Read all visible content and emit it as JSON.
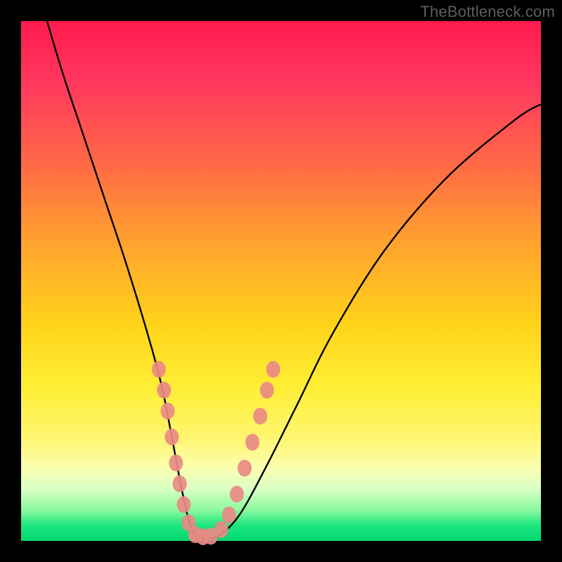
{
  "watermark": "TheBottleneck.com",
  "chart_data": {
    "type": "line",
    "title": "",
    "xlabel": "",
    "ylabel": "",
    "xlim": [
      0,
      100
    ],
    "ylim": [
      0,
      100
    ],
    "series": [
      {
        "name": "bottleneck-curve",
        "x": [
          5,
          8,
          12,
          16,
          20,
          24,
          27,
          29,
          30.5,
          32,
          33.5,
          35,
          38,
          42,
          47,
          53,
          60,
          70,
          82,
          95,
          100
        ],
        "y": [
          100,
          90,
          78,
          66,
          54,
          41,
          30,
          20,
          12,
          5,
          1,
          0.5,
          1,
          5,
          14,
          26,
          40,
          56,
          70,
          81,
          84
        ]
      }
    ],
    "markers": {
      "name": "highlighted-points",
      "color": "#e98a84",
      "points": [
        {
          "x": 26.5,
          "y": 33
        },
        {
          "x": 27.5,
          "y": 29
        },
        {
          "x": 28.2,
          "y": 25
        },
        {
          "x": 29.0,
          "y": 20
        },
        {
          "x": 29.8,
          "y": 15
        },
        {
          "x": 30.5,
          "y": 11
        },
        {
          "x": 31.3,
          "y": 7
        },
        {
          "x": 32.2,
          "y": 3.5
        },
        {
          "x": 33.5,
          "y": 1.2
        },
        {
          "x": 35.0,
          "y": 0.8
        },
        {
          "x": 36.5,
          "y": 0.9
        },
        {
          "x": 38.5,
          "y": 2.2
        },
        {
          "x": 40.0,
          "y": 5
        },
        {
          "x": 41.5,
          "y": 9
        },
        {
          "x": 43.0,
          "y": 14
        },
        {
          "x": 44.5,
          "y": 19
        },
        {
          "x": 46.0,
          "y": 24
        },
        {
          "x": 47.3,
          "y": 29
        },
        {
          "x": 48.5,
          "y": 33
        }
      ]
    }
  }
}
